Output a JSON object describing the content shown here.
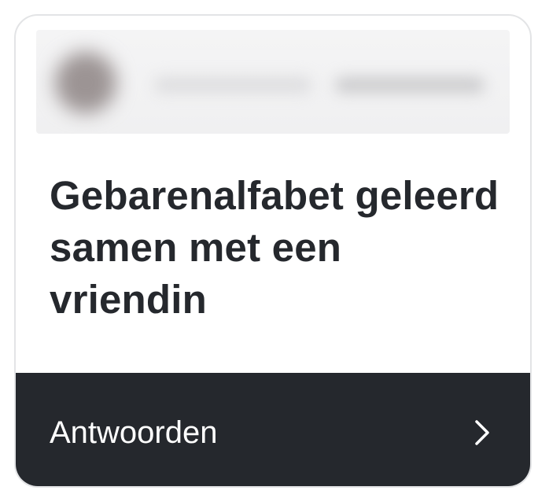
{
  "card": {
    "title": "Gebarenalfabet geleerd samen met een vriendin",
    "reply_label": "Antwoorden"
  },
  "icons": {
    "reply_chevron": "chevron-right-icon"
  },
  "colors": {
    "card_border": "#e3e4e6",
    "title_text": "#25282d",
    "reply_bar_bg": "#25282d",
    "reply_text": "#ffffff"
  }
}
